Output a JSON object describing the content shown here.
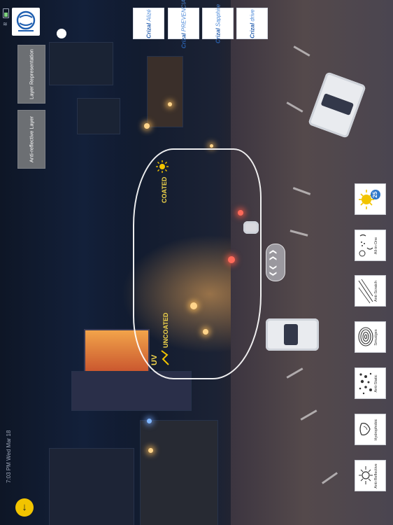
{
  "status_bar": {
    "time_date": "7:03 PM  Wed Mar 18"
  },
  "side_buttons": {
    "layer_representation": "Layer Representation",
    "anti_reflective_layer": "Anti-reflective Layer"
  },
  "brands": [
    {
      "name": "Crizal",
      "suffix": "Alizé"
    },
    {
      "name": "Crizal",
      "suffix": "PREVENCIA"
    },
    {
      "name": "Crizal",
      "suffix": "Sapphire"
    },
    {
      "name": "Crizal",
      "suffix": "drive"
    }
  ],
  "lens": {
    "coated_label": "COATED",
    "uncoated_label": "UNCOATED",
    "uv_label": "UV"
  },
  "features": [
    {
      "label": "Anti-Reflective",
      "icon": "sun-ray-icon"
    },
    {
      "label": "Hydrophobic",
      "icon": "water-drop-icon"
    },
    {
      "label": "Anti-Static",
      "icon": "particles-icon"
    },
    {
      "label": "Smudges",
      "icon": "fingerprint-icon"
    },
    {
      "label": "Anti-Scratch",
      "icon": "scratch-icon"
    },
    {
      "label": "All-in-One",
      "icon": "all-in-one-icon"
    }
  ],
  "uv_badge": {
    "number": "25",
    "icon": "sun-protection-icon"
  },
  "colors": {
    "accent_yellow": "#f2c400",
    "lens_outline": "#ffffff",
    "label_yellow": "#f2d64b",
    "crizal_blue": "#2a62b0"
  }
}
